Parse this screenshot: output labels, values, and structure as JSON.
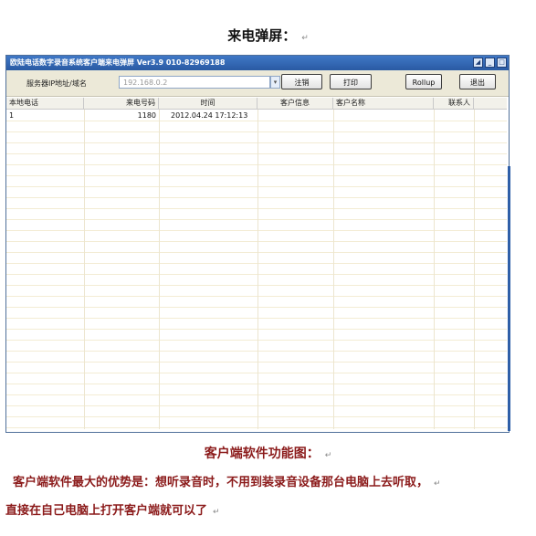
{
  "page_heading": "来电弹屏：",
  "window": {
    "title": "欧陆电话数字录音系统客户端来电弹屏 Ver3.9 010-82969188",
    "server_label": "服务器IP地址/域名",
    "server_value": "192.168.0.2",
    "buttons": {
      "logout": "注销",
      "print": "打印",
      "rollup": "Rollup",
      "exit": "退出"
    },
    "columns": [
      "本地电话",
      "来电号码",
      "时间",
      "客户信息",
      "客户名称",
      "联系人"
    ],
    "rows": [
      {
        "local": "1",
        "caller": "1180",
        "time": "2012.04.24 17:12:13",
        "info": "",
        "name": "",
        "contact": ""
      }
    ]
  },
  "caption": "客户端软件功能图：",
  "para1": "客户端软件最大的优势是：想听录音时，不用到装录音设备那台电脑上去听取，",
  "para2": "直接在自己电脑上打开客户端就可以了",
  "para_mark": "↵"
}
